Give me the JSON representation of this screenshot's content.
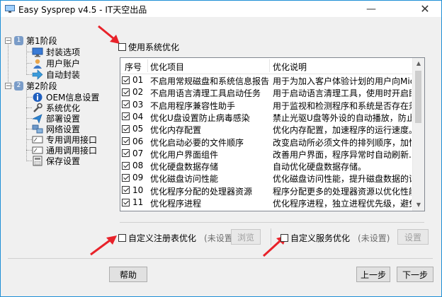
{
  "window": {
    "title": "Easy Sysprep v4.5 - IT天空出品",
    "minimize_glyph": "—",
    "close_glyph": "✕"
  },
  "tree": {
    "stage1": {
      "badge": "1",
      "label": "第1阶段",
      "expander": "−"
    },
    "stage1_items": [
      {
        "label": "封装选项",
        "icon": "monitor-icon"
      },
      {
        "label": "用户账户",
        "icon": "user-icon"
      },
      {
        "label": "自动封装",
        "icon": "arrow-right-icon"
      }
    ],
    "stage2": {
      "badge": "2",
      "label": "第2阶段",
      "expander": "−"
    },
    "stage2_items": [
      {
        "label": "OEM信息设置",
        "icon": "info-icon"
      },
      {
        "label": "系统优化",
        "icon": "wrench-icon"
      },
      {
        "label": "部署设置",
        "icon": "deploy-icon"
      },
      {
        "label": "网络设置",
        "icon": "network-icon"
      },
      {
        "label": "专用调用接口",
        "icon": "interface-icon"
      },
      {
        "label": "通用调用接口",
        "icon": "interface-icon"
      },
      {
        "label": "保存设置",
        "icon": "save-icon"
      }
    ]
  },
  "use_system_opt": {
    "label": "使用系统优化",
    "checked": false
  },
  "table": {
    "headers": [
      "序号",
      "优化项目",
      "优化说明"
    ],
    "rows": [
      {
        "num": "01",
        "name": "不启用常规磁盘和系统信息报告",
        "desc": "用于为加入客户体验计划的用户向Micro..."
      },
      {
        "num": "02",
        "name": "不启用语言清理工具启动任务",
        "desc": "用于启动语言清理工具，使用时开启即可..."
      },
      {
        "num": "03",
        "name": "不启用程序兼容性助手",
        "desc": "用于监视和检测程序和系统是否存在兼容..."
      },
      {
        "num": "04",
        "name": "优化U盘设置防止病毒感染",
        "desc": "禁止光驱U盘等外设的自动播放，防止被..."
      },
      {
        "num": "05",
        "name": "优化内存配置",
        "desc": "优化内存配置，加速程序的运行速度。"
      },
      {
        "num": "06",
        "name": "优化启动必要的文件顺序",
        "desc": "改变启动所必须文件的排列顺序，加快开..."
      },
      {
        "num": "07",
        "name": "优化用户界面组件",
        "desc": "改善用户界面，程序异常时自动刷新..."
      },
      {
        "num": "08",
        "name": "优化硬盘数据存储",
        "desc": "自动优化硬盘数据存储。"
      },
      {
        "num": "09",
        "name": "优化磁盘访问性能",
        "desc": "优化磁盘访问性能，提升磁盘数据的读写..."
      },
      {
        "num": "10",
        "name": "优化程序分配的处理器资源",
        "desc": "程序分配更多的处理器资源以优化性能。"
      },
      {
        "num": "11",
        "name": "优化程序进程",
        "desc": "优化程序进程，独立进程优先级，避免系..."
      }
    ]
  },
  "custom_registry": {
    "label": "自定义注册表优化",
    "status": "(未设置)",
    "button": "浏览"
  },
  "custom_service": {
    "label": "自定义服务优化",
    "status": "(未设置)",
    "button": "设置"
  },
  "buttons": {
    "help": "帮助",
    "prev": "上一步",
    "next": "下一步"
  },
  "colors": {
    "accent_arrow": "#e8222a",
    "window_border": "#1f8fd6"
  }
}
